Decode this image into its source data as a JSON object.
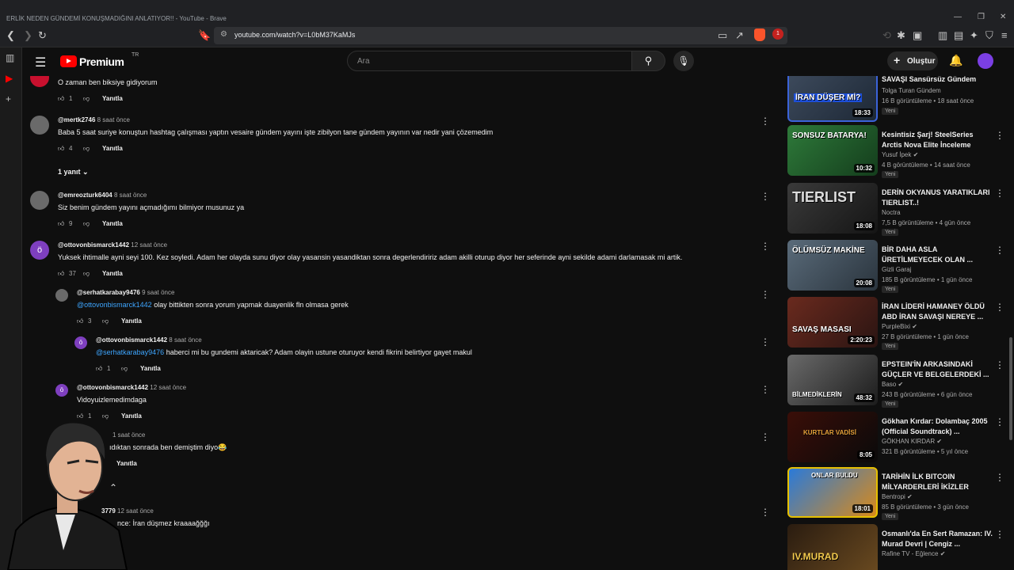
{
  "window": {
    "title": "ERLİK NEDEN GÜNDEMİ KONUŞMADIĞINI ANLATIYOR!! - YouTube - Brave",
    "url": "youtube.com/watch?v=L0bM37KaMJs",
    "brave_badge": "1"
  },
  "header": {
    "logo_text": "Premium",
    "logo_country": "TR",
    "search_placeholder": "Ara",
    "create_label": "Oluştur"
  },
  "comments": [
    {
      "avatar_letter": "",
      "author": "",
      "time": "",
      "text": "O zaman ben biksiye gidiyorum",
      "likes": "1",
      "reply_label": "Yanıtla"
    },
    {
      "avatar_letter": "",
      "author": "@mertk2746",
      "time": "8 saat önce",
      "text": "Baba 5 saat suriye konuştun hashtag çalışması yaptın vesaire gündem yayını işte zibilyon tane gündem yayının var nedir yani çözemedim",
      "likes": "4",
      "reply_label": "Yanıtla",
      "replies_toggle": "1 yanıt"
    },
    {
      "avatar_letter": "",
      "author": "@emreozturk6404",
      "time": "8 saat önce",
      "text": "Siz benim gündem yayını açmadığımı bilmiyor musunuz ya",
      "likes": "9",
      "reply_label": "Yanıtla"
    },
    {
      "avatar_letter": "ö",
      "author": "@ottovonbismarck1442",
      "time": "12 saat önce",
      "text": "Yuksek ihtimalle ayni seyi 100. Kez soyledi. Adam her olayda sunu diyor olay yasansin yasandiktan sonra degerlendiririz adam akilli oturup diyor her seferinde ayni sekilde adami darlamasak mi artik.",
      "likes": "37",
      "reply_label": "Yanıtla"
    },
    {
      "avatar_letter": "",
      "author": "@serhatkarabay9476",
      "time": "9 saat önce",
      "mention": "@ottovonbismarck1442",
      "text": " olay bittikten sonra yorum yapmak duayenlik fln olmasa gerek",
      "likes": "3",
      "reply_label": "Yanıtla"
    },
    {
      "avatar_letter": "ö",
      "author": "@ottovonbismarck1442",
      "time": "8 saat önce",
      "mention": "@serhatkarabay9476",
      "text": " haberci mi bu gundemi aktaricak? Adam olayin ustune oturuyor kendi fikrini belirtiyor gayet makul",
      "likes": "1",
      "reply_label": "Yanıtla"
    },
    {
      "avatar_letter": "ö",
      "author": "@ottovonbismarck1442",
      "time": "12 saat önce",
      "text": "Vidoyuizlemedimdaga",
      "likes": "1",
      "reply_label": "Yanıtla"
    },
    {
      "avatar_letter": "",
      "author": "",
      "time": "1 saat önce",
      "text": "ıdıktan sonrada ben demiştim diyo😂",
      "likes": "",
      "reply_label": "Yanıtla"
    },
    {
      "avatar_letter": "",
      "author": "3779",
      "time": "12 saat önce",
      "text": "nce: İran düşmez kraaaağğğı",
      "likes": "",
      "reply_label": ""
    }
  ],
  "recommendations": [
    {
      "thumb_caption": "İRAN DÜŞER Mİ?",
      "duration": "18:33",
      "title": "SAVAŞI Sansürsüz Gündem",
      "channel": "Tolga Turan Gündem",
      "verified": false,
      "views": "16 B görüntüleme • 18 saat önce",
      "badge": "Yeni"
    },
    {
      "thumb_caption": "SONSUZ BATARYA!",
      "duration": "10:32",
      "title": "Kesintisiz Şarj! SteelSeries Arctis Nova Elite İnceleme",
      "channel": "Yusuf İpek",
      "verified": true,
      "views": "4 B görüntüleme • 14 saat önce",
      "badge": "Yeni"
    },
    {
      "thumb_caption": "TIERLIST",
      "duration": "18:08",
      "title": "DERİN OKYANUS YARATIKLARI TIERLIST..!",
      "channel": "Noctra",
      "verified": false,
      "views": "7,5 B görüntüleme • 4 gün önce",
      "badge": "Yeni"
    },
    {
      "thumb_caption": "ÖLÜMSÜZ MAKİNE",
      "duration": "20:08",
      "title": "BİR DAHA ASLA ÜRETİLMEYECEK OLAN ...",
      "channel": "Gizli Garaj",
      "verified": false,
      "views": "185 B görüntüleme • 1 gün önce",
      "badge": "Yeni"
    },
    {
      "thumb_caption": "SAVAŞ MASASI",
      "duration": "2:20:23",
      "title": "İRAN LİDERİ HAMANEY ÖLDÜ ABD İRAN SAVAŞI NEREYE ...",
      "channel": "PurpleBixi",
      "verified": true,
      "views": "27 B görüntüleme • 1 gün önce",
      "badge": "Yeni"
    },
    {
      "thumb_caption": "BİLMEDİKLERİN",
      "duration": "48:32",
      "title": "EPSTEIN'İN ARKASINDAKİ GÜÇLER VE BELGELERDEKİ ...",
      "channel": "Baso",
      "verified": true,
      "views": "243 B görüntüleme • 6 gün önce",
      "badge": "Yeni"
    },
    {
      "thumb_caption": "KURTLAR VADİSİ",
      "duration": "8:05",
      "title": "Gökhan Kırdar: Dolambaç 2005 (Official Soundtrack) ...",
      "channel": "GÖKHAN KIRDAR",
      "verified": true,
      "views": "321 B görüntüleme • 5 yıl önce",
      "badge": ""
    },
    {
      "thumb_caption": "ONLAR BULDU",
      "duration": "18:01",
      "title": "TARİHİN İLK BITCOIN MİLYARDERLERİ İKİZLER",
      "channel": "Bentropi",
      "verified": true,
      "views": "85 B görüntüleme • 3 gün önce",
      "badge": "Yeni"
    },
    {
      "thumb_caption": "IV.MURAD",
      "duration": "",
      "title": "Osmanlı'da En Sert Ramazan: IV. Murad Devri | Cengiz ...",
      "channel": "Rafine TV - Eğlence",
      "verified": true,
      "views": "",
      "badge": ""
    }
  ],
  "colors": {
    "accent_red": "#ff0000",
    "mention_blue": "#3ea6ff",
    "bg": "#0f0f0f"
  }
}
